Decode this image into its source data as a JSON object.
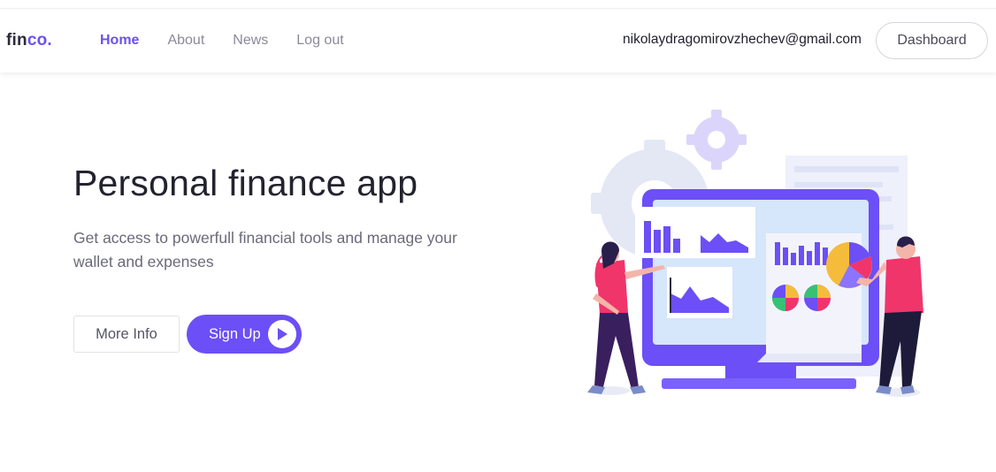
{
  "nav": {
    "logo_part1": "fin",
    "logo_part2": "co.",
    "links": [
      {
        "label": "Home",
        "active": true
      },
      {
        "label": "About",
        "active": false
      },
      {
        "label": "News",
        "active": false
      },
      {
        "label": "Log out",
        "active": false
      }
    ],
    "user_email": "nikolaydragomirovzhechev@gmail.com",
    "dashboard_label": "Dashboard"
  },
  "hero": {
    "title": "Personal finance app",
    "subtitle": "Get access to powerfull financial tools and manage your wallet and expenses",
    "more_info_label": "More Info",
    "signup_label": "Sign Up"
  },
  "icons": {
    "play": "play-icon",
    "illustration": "finance-dashboard-illustration"
  },
  "colors": {
    "accent": "#6c4ff6",
    "text_dark": "#23232f",
    "text_muted": "#6a6a7a",
    "nav_muted": "#8a8a99",
    "illustration_pink": "#f0356b",
    "illustration_yellow": "#f5bc3c",
    "illustration_blue_light": "#d6e6fb"
  }
}
